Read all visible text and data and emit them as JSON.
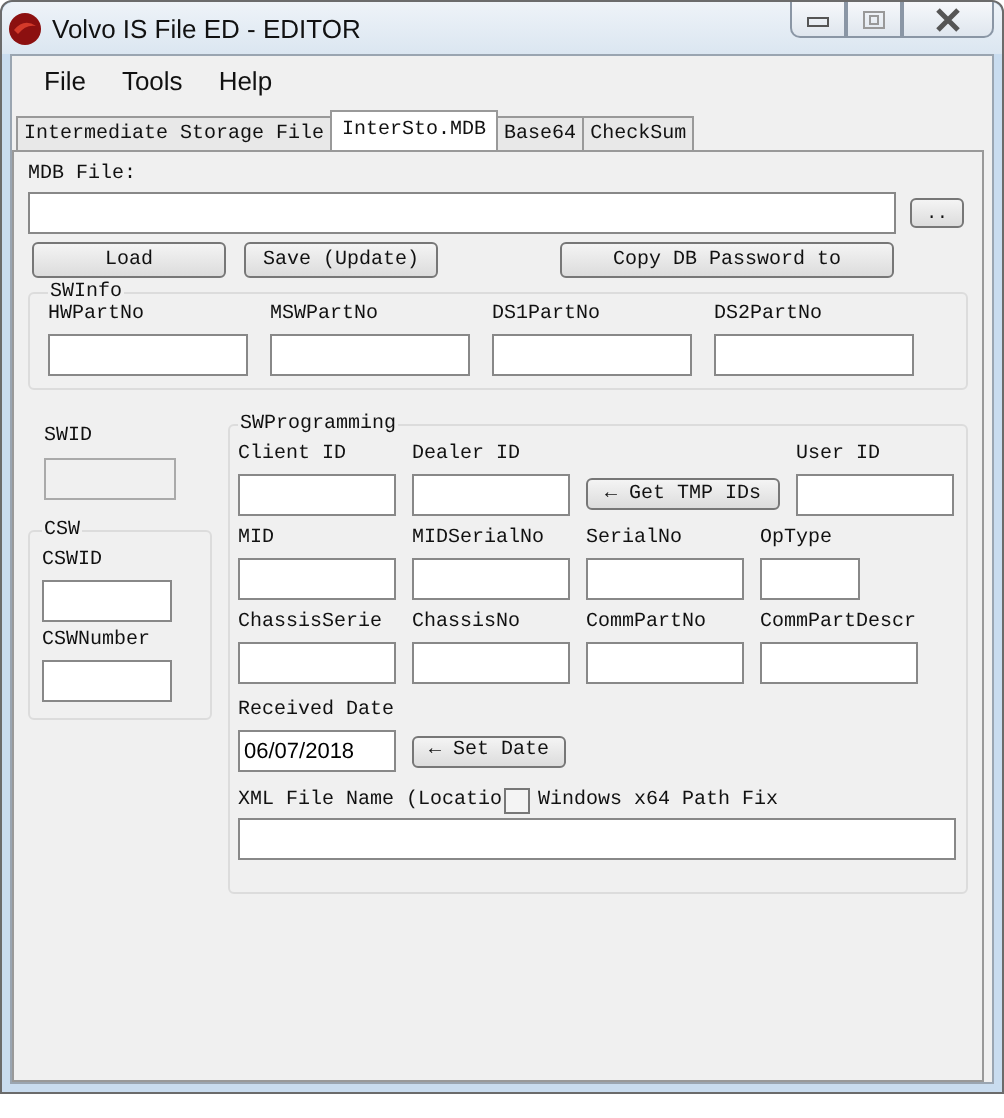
{
  "window": {
    "title": "Volvo IS File ED - EDITOR"
  },
  "menu": [
    "File",
    "Tools",
    "Help"
  ],
  "tabs": [
    {
      "label": "Intermediate Storage File",
      "selected": false
    },
    {
      "label": "InterSto.MDB",
      "selected": true
    },
    {
      "label": "Base64",
      "selected": false
    },
    {
      "label": "CheckSum",
      "selected": false
    }
  ],
  "mdb_file": {
    "label": "MDB File:",
    "browse_button": ".."
  },
  "buttons": [
    "Load",
    "Save (Update)",
    "Copy DB Password to"
  ],
  "swinfo": {
    "title": "SWInfo",
    "fields": [
      {
        "label": "HWPartNo"
      },
      {
        "label": "MSWPartNo"
      },
      {
        "label": "DS1PartNo"
      },
      {
        "label": "DS2PartNo"
      }
    ]
  },
  "swid": {
    "label": "SWID",
    "disabled": true
  },
  "csw": {
    "title": "CSW",
    "fields": [
      {
        "label": "CSWID"
      },
      {
        "label": "CSWNumber"
      }
    ]
  },
  "swprogramming": {
    "title": "SWProgramming",
    "rows": [
      [
        {
          "kind": "field",
          "label": "Client ID"
        },
        {
          "kind": "field",
          "label": "Dealer ID"
        },
        {
          "kind": "button",
          "label": "← Get TMP IDs"
        },
        {
          "kind": "field",
          "label": "User ID"
        }
      ],
      [
        {
          "kind": "field",
          "label": "MID"
        },
        {
          "kind": "field",
          "label": "MIDSerialNo"
        },
        {
          "kind": "field",
          "label": "SerialNo"
        },
        {
          "kind": "short-field",
          "label": "OpType"
        }
      ],
      [
        {
          "kind": "field",
          "label": "ChassisSerie"
        },
        {
          "kind": "field",
          "label": "ChassisNo"
        },
        {
          "kind": "field",
          "label": "CommPartNo"
        },
        {
          "kind": "field",
          "label": "CommPartDescr"
        }
      ]
    ],
    "received_date": {
      "label": "Received Date",
      "value": "06/07/2018",
      "button": "← Set Date"
    },
    "xml_file": {
      "label": "XML File Name (Locatio",
      "checkbox": {
        "label": "Windows x64 Path Fix",
        "checked": false
      }
    }
  }
}
